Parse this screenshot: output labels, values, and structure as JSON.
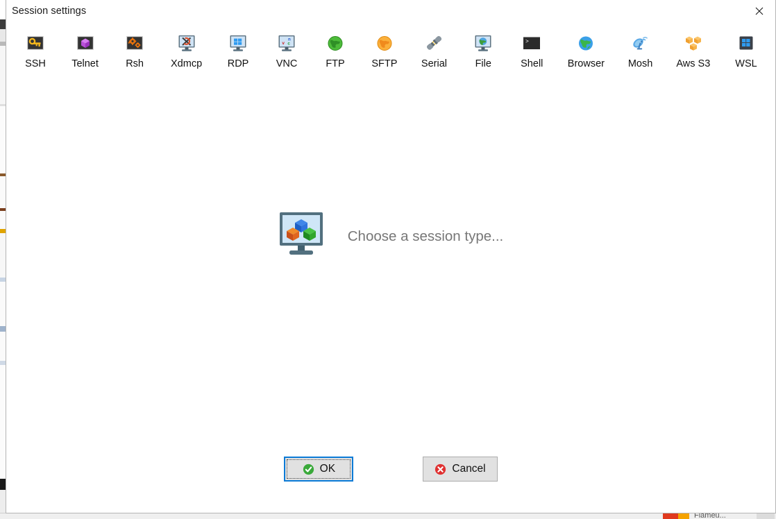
{
  "window": {
    "title": "Session settings",
    "close_icon": "close-icon"
  },
  "toolbar": {
    "items": [
      {
        "label": "SSH",
        "icon": "ssh-key-terminal-icon"
      },
      {
        "label": "Telnet",
        "icon": "telnet-gem-icon"
      },
      {
        "label": "Rsh",
        "icon": "rsh-gears-icon"
      },
      {
        "label": "Xdmcp",
        "icon": "xdmcp-monitor-x-icon"
      },
      {
        "label": "RDP",
        "icon": "rdp-monitor-windows-icon"
      },
      {
        "label": "VNC",
        "icon": "vnc-monitor-letters-icon"
      },
      {
        "label": "FTP",
        "icon": "ftp-green-globe-icon"
      },
      {
        "label": "SFTP",
        "icon": "sftp-orange-globe-icon"
      },
      {
        "label": "Serial",
        "icon": "serial-plug-icon"
      },
      {
        "label": "File",
        "icon": "file-monitor-globe-icon"
      },
      {
        "label": "Shell",
        "icon": "shell-terminal-icon"
      },
      {
        "label": "Browser",
        "icon": "browser-globe-icon"
      },
      {
        "label": "Mosh",
        "icon": "mosh-satellite-dish-icon"
      },
      {
        "label": "Aws S3",
        "icon": "aws-s3-cubes-icon"
      },
      {
        "label": "WSL",
        "icon": "wsl-windows-icon"
      }
    ]
  },
  "main": {
    "placeholder_text": "Choose a session type...",
    "placeholder_icon": "monitor-cubes-icon"
  },
  "footer": {
    "ok_label": "OK",
    "ok_icon": "green-check-icon",
    "cancel_label": "Cancel",
    "cancel_icon": "red-x-icon"
  },
  "background": {
    "bottom_text": "Flameu..."
  },
  "colors": {
    "dialog_background": "#ffffff",
    "focus_border": "#0a7ad6",
    "button_face": "#e1e1e1",
    "placeholder_text": "#777777",
    "label_text": "#111111",
    "ok_accent": "#3aa93a",
    "cancel_accent": "#e03030"
  }
}
